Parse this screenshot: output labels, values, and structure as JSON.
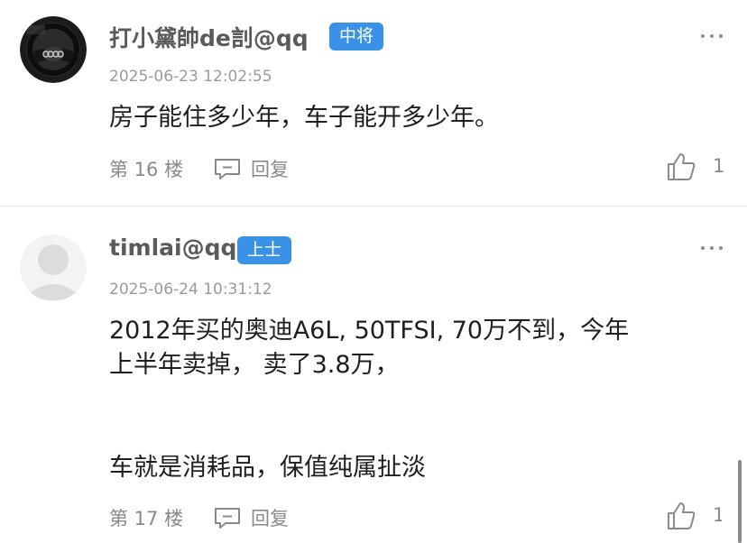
{
  "posts": [
    {
      "username": "打小黛帥de䚯@qq",
      "rank_badge": "中将",
      "timestamp": "2025-06-23 12:02:55",
      "content_lines": [
        "房子能住多少年，车子能开多少年。"
      ],
      "floor": "第 16 楼",
      "reply_label": "回复",
      "like_count": "1",
      "avatar_icon": "steering-wheel-avatar"
    },
    {
      "username": "timlai@qq",
      "rank_badge": "上士",
      "timestamp": "2025-06-24 10:31:12",
      "content_lines": [
        "2012年买的奥迪A6L, 50TFSI, 70万不到，今年",
        "上半年卖掉，  卖了3.8万，",
        "车就是消耗品，保值纯属扯淡"
      ],
      "floor": "第 17 楼",
      "reply_label": "回复",
      "like_count": "1",
      "avatar_icon": "default-user-avatar"
    }
  ],
  "colors": {
    "badge": "#3a92e8",
    "username": "#5a5a5a",
    "meta": "#9a9a9a",
    "content": "#1f1f1f"
  },
  "icons": [
    "more-icon",
    "reply-icon",
    "like-icon"
  ]
}
